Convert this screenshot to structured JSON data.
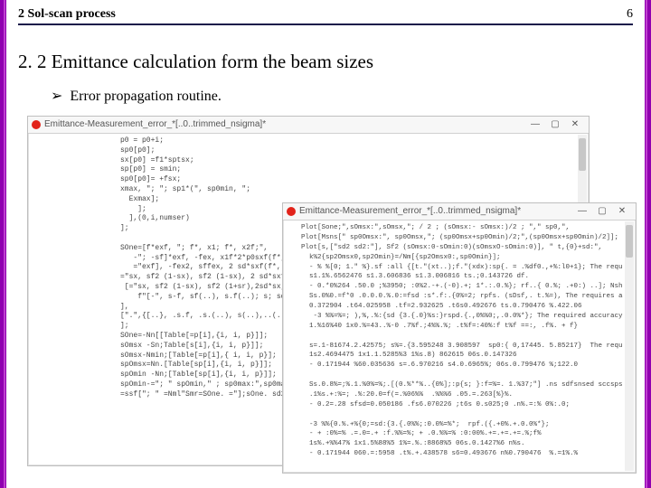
{
  "header": {
    "title": "2 Sol-scan process",
    "page": "6"
  },
  "section_heading": "2. 2 Emittance calculation form the beam sizes",
  "bullet": {
    "marker": "➢",
    "text": "Error propagation routine."
  },
  "windowA": {
    "title": "Emittance-Measurement_error_*[..0..trimmed_nsigma]*",
    "btn_min": "—",
    "btn_max": "▢",
    "btn_close": "✕",
    "code": "p0 = p0+i;\nsp0[p0];\nsx[p0] =f1*sptsx;\nsp[p0] = smin;\nsp0[p0]= +fsx;\nxmax, \"; \"; sp1*(\", sp0min, \";\n  Exmax];\n    ];\n  ],(0,i,numser)\n];\n\nSOne=[f*exf, \"; f*, x1; f*, x2f;\",\n   -\"; -sf]*exf, -fex, x1f*2*p0sxf(f*,],\n   =\"exf], -fex2, sffex, 2 sd*sxf(f*,\n=\"sx, sf2 (1-sx), sf2 (1-sx), 2 sd*sxf,\n [=\"sx, sf2 (1-sx), sf2 (1+sr),2sd*sx,\n    f\"[-\", s-f, sf(..), s.f(..); s; sdsx f(-1)]]\n],\n[\".\",{[..}, .s.f, .s.(..), s(..),..(..),(.(..))]]\n];\nSOne=-Nn[[Table[=p[i],{i, i, p}]];\nsOmsx -Sn;Table[s[i],{i, i, p}]];\nsOmsx-Nmin;[Table[=p[i],{ i, i, p}];\nspOmsx=Nn.[Table[sp[i],{i, i, p}]];\nspOmin -Nn;[Table[sp[i],{i, i, p}]];\nspOmin-=\"; \" spOmin,\" ; sp0max:\",sp0max];\n=ssf[\"; \" =Nml\"Smr=SOne. =\"];sOne. sd2.sf2.=df1: te2[2.: ..];"
  },
  "windowB": {
    "title": "Emittance-Measurement_error_*[..0..trimmed_nsigma]*",
    "btn_min": "—",
    "btn_max": "▢",
    "btn_close": "✕",
    "code": "Plot[Sone;\",sOmsx:\",sOmsx,\"; / 2 ; (sOmsx:- sOmsx:)/2 ; \",\" sp0,\",\nPlot[Msns[\" sp0Omsx:\", sp0Omsx,\"; (sp0Omsx+sp0Omin)/2;\",(sp0Omsx+sp0Omin)/2]];\nPlot[s,[\"sd2 sd2:\"], Sf2 (sOmsx:0-sOmin:0)(sOmsxO-sOmin:0)], \" t,{0}+sd:\",\n  k%2{sp2Omsx0,sp2Omin}=/Nm[{sp2Omsx0:,sp0Omin}];\n  - % %[0; 1.\" %}.sf :all {[t.\"(xt..);f.\"(xdx):sp{. = .%df0.,+%:l0+1}; The required accuracy is achieved.\n  s1.1%.6562476 s1.3.606836 s1.3.006816 ts.;0.143726 df.\n  - 0.*0%264 .50.0 ;%3950; :0%2.-+.(-0).+; 1*.:.0.%}; rf..{ 0.%; .+0:) ..]; Nsh; The requires accuracy is achieved.\n  Ss.0%0.=f*0 .0.0.0.%.0:=fsd :s*.f:.{0%=2; rpfs. (sDsf,. t.%=), The requires accuracy of achieved.\n  0.372904 .t64.025958 .tf=2.932625 .t6s0.492676 ts.0.790476 %.422.06\n   -3 %%=%=; ),%,.%:{sd {3.{.0}%s:}rspd.{.,0%%0;,.0.0%*}; The required accuracy is archived\n  1.%16%40 1x0.%=43..%-0 .7%f.;4%%.%; .t%f=:40%:f t%f ==:, .f%. + f}\n\n  s=.1-81674.2.42575; s%=.{3.595248 3.908597  sp0:{ 0,17445. 5.85217}  The required accuracy is achieved.\n  1s2.4694475 1x1.1.5285%3 1%s.8) 862615 06s.0.147326\n  - 0.171944 %60.035636 s=.6.970216 s4.0.6965%; 06s.0.799476 %;122.0\n\n  Ss.0.8%=;%.1.%0%=%;.[(0.%**%..{0%];:p{s; }:f=%=. 1.%37;\"] .ns sdfsnsed sccspsos = smfemk.\n  .1%s.+:%=; .%:20.0=f(=.%06%%  .%%%6 .05.=.263[%}%.\n  - 0.2=.28 sfsd=0.050186 .fs6.070226 ;t6s 0.s025;0 .n%.=:% 0%:.0;\n\n  -3 %%{0.%.+%{0;=sd:{3.{.0%%;:0.0%=%*;  rpf.({.+0%.+.0.0%*};\n  - + :0%=% .=.0=.+ :f.%%=%; + .0.%%=% :0:00%.+=.+=.+=.%;f%\n  1s%.+%%47% 1x1.5%88%5 1%=.%.:8868%5 06s.0.1427%6 n%s.\n  - 0.171944 060.=:5958 .t%.+.438578 s6=0.493676 n%0.790476  %.=1%.%\n\n.s:(*f  =%:0.[%(s.=0),.s:(t.};s,.:(frs..snls).df.{.;sds%..0%;t%f{2.;.;"
  }
}
